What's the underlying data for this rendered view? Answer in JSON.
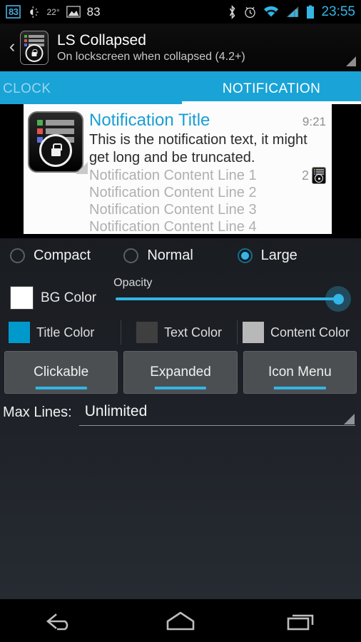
{
  "statusbar": {
    "badge": "83",
    "temperature": "22°",
    "photo_count": "83",
    "clock": "23:55",
    "icons_left": [
      "counter-badge-icon",
      "brightness-icon",
      "photo-icon"
    ],
    "icons_right": [
      "bluetooth-icon",
      "alarm-icon",
      "wifi-icon",
      "signal-icon",
      "battery-icon"
    ]
  },
  "actionbar": {
    "back_glyph": "‹",
    "title": "LS Collapsed",
    "subtitle": "On lockscreen when collapsed (4.2+)",
    "app_icon": "notification-lock-icon",
    "overflow_icon": "spinner-triangle-icon"
  },
  "tabs": [
    {
      "label": "CLOCK",
      "active": false
    },
    {
      "label": "NOTIFICATION",
      "active": true
    }
  ],
  "preview": {
    "title": "Notification Title",
    "time": "9:21",
    "text": "This is the notification text, it might get long and be truncated.",
    "content_lines": [
      "Notification Content Line 1",
      "Notification Content Line 2",
      "Notification Content Line 3",
      "Notification Content Line 4"
    ],
    "count": "2",
    "icon": "notification-lock-icon",
    "small_icon": "notification-lock-small-icon"
  },
  "size_options": [
    {
      "label": "Compact",
      "selected": false
    },
    {
      "label": "Normal",
      "selected": false
    },
    {
      "label": "Large",
      "selected": true
    }
  ],
  "bg": {
    "swatch_label": "BG Color",
    "swatch_color": "#ffffff",
    "opacity_label": "Opacity",
    "opacity_value": "100"
  },
  "colors": [
    {
      "label": "Title Color",
      "color": "#0099cc"
    },
    {
      "label": "Text Color",
      "color": "#3f3f3f"
    },
    {
      "label": "Content Color",
      "color": "#b8b8b8"
    }
  ],
  "buttons": [
    {
      "label": "Clickable"
    },
    {
      "label": "Expanded"
    },
    {
      "label": "Icon Menu"
    }
  ],
  "max_lines": {
    "label": "Max Lines:",
    "value": "Unlimited"
  },
  "navbar": {
    "back": "back-icon",
    "home": "home-icon",
    "recents": "recents-icon"
  },
  "theme": {
    "accent": "#33b5e5",
    "tab_blue": "#19a3d6",
    "title_blue": "#1a9fd4"
  }
}
